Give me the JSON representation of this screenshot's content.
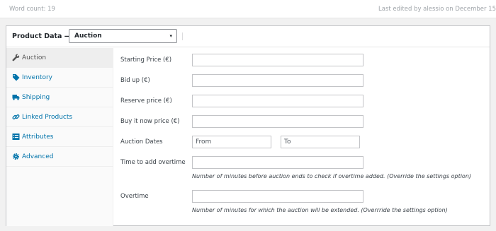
{
  "status": {
    "word_count": "Word count: 19",
    "last_edited": "Last edited by alessio on December 15"
  },
  "product_data": {
    "title": "Product Data —",
    "type_selected": "Auction",
    "caret": "▾"
  },
  "tabs": [
    {
      "label": "Auction",
      "icon": "wrench-icon",
      "active": true
    },
    {
      "label": "Inventory",
      "icon": "tag-icon"
    },
    {
      "label": "Shipping",
      "icon": "truck-icon"
    },
    {
      "label": "Linked Products",
      "icon": "link-icon"
    },
    {
      "label": "Attributes",
      "icon": "list-icon"
    },
    {
      "label": "Advanced",
      "icon": "gear-icon"
    }
  ],
  "fields": {
    "starting_price": "Starting Price (€)",
    "bid_up": "Bid up (€)",
    "reserve_price": "Reserve price (€)",
    "buy_now_price": "Buy it now price (€)",
    "auction_dates": "Auction Dates",
    "from_placeholder": "From",
    "to_placeholder": "To",
    "time_overtime": "Time to add overtime",
    "time_overtime_desc": "Number of minutes before auction ends to check if overtime added. (Override the settings option)",
    "overtime": "Overtime",
    "overtime_desc": "Number of minutes for which the auction will be extended. (Overrride the settings option)"
  },
  "colors": {
    "link": "#0073aa",
    "active_tab_bg": "#eeeeee"
  }
}
